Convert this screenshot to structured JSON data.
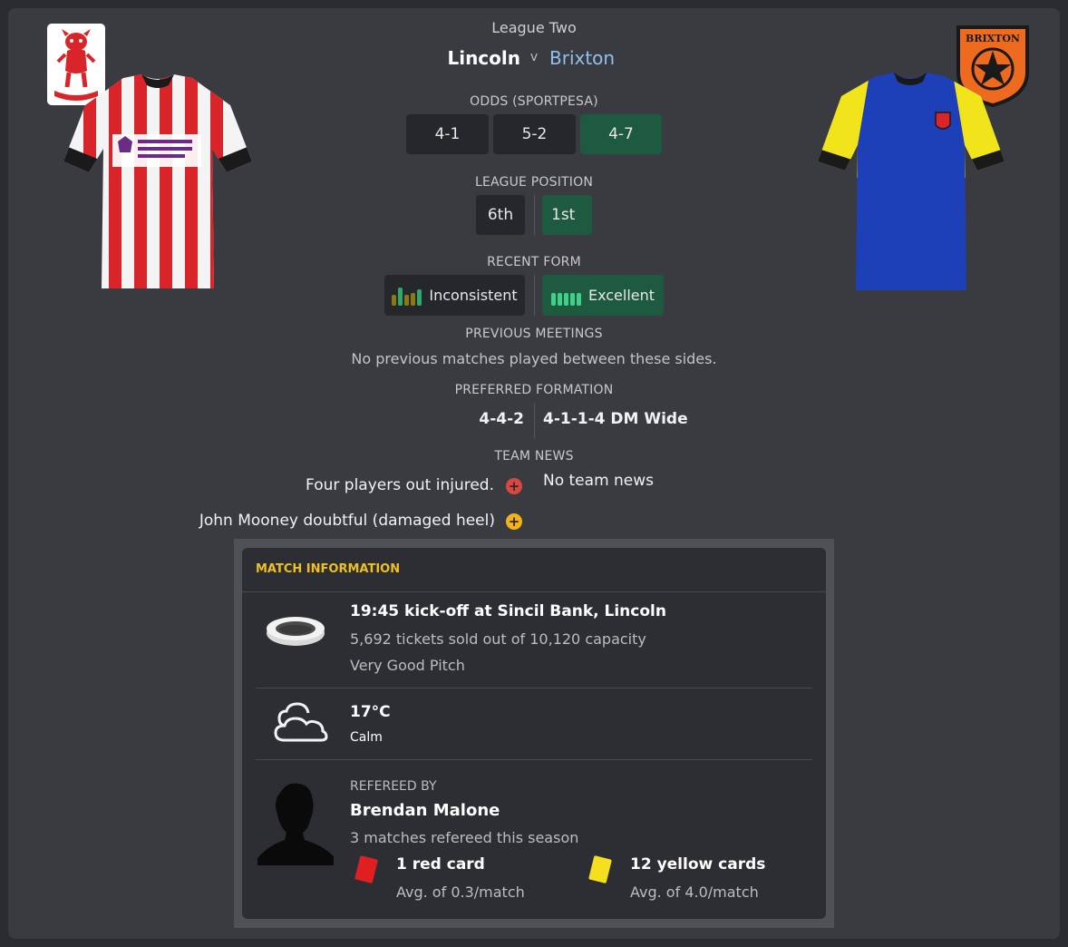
{
  "header": {
    "competition": "League Two",
    "home_team": "Lincoln",
    "versus": "v",
    "away_team": "Brixton"
  },
  "away_crest_text": "BRIXTON",
  "odds": {
    "label": "ODDS (SPORTPESA)",
    "home": "4-1",
    "draw": "5-2",
    "away": "4-7"
  },
  "league_position": {
    "label": "LEAGUE POSITION",
    "home": "6th",
    "away": "1st"
  },
  "recent_form": {
    "label": "RECENT FORM",
    "home": "Inconsistent",
    "away": "Excellent"
  },
  "previous_meetings": {
    "label": "PREVIOUS MEETINGS",
    "text": "No previous matches played between these sides."
  },
  "preferred_formation": {
    "label": "PREFERRED FORMATION",
    "home": "4-4-2",
    "away": "4-1-1-4 DM Wide"
  },
  "team_news": {
    "label": "TEAM NEWS",
    "home": [
      "Four players out injured.",
      "John Mooney doubtful (damaged heel)"
    ],
    "away": "No team news"
  },
  "match_info": {
    "title": "MATCH INFORMATION",
    "venue_line": "19:45 kick-off at Sincil Bank, Lincoln",
    "tickets": "5,692 tickets sold out of 10,120 capacity",
    "pitch": "Very Good Pitch",
    "temperature": "17°C",
    "wind": "Calm",
    "referee_label": "REFEREED BY",
    "referee_name": "Brendan Malone",
    "referee_matches": "3 matches refereed this season",
    "red_cards": "1 red card",
    "red_avg": "Avg. of 0.3/match",
    "yellow_cards": "12 yellow cards",
    "yellow_avg": "Avg. of 4.0/match"
  },
  "colors": {
    "accent_green": "#1e5a3f",
    "away_team_link": "#8fc0ee",
    "match_info_title": "#f0c020",
    "injury_icon": "#d9473f",
    "doubtful_icon": "#f2b21c"
  }
}
